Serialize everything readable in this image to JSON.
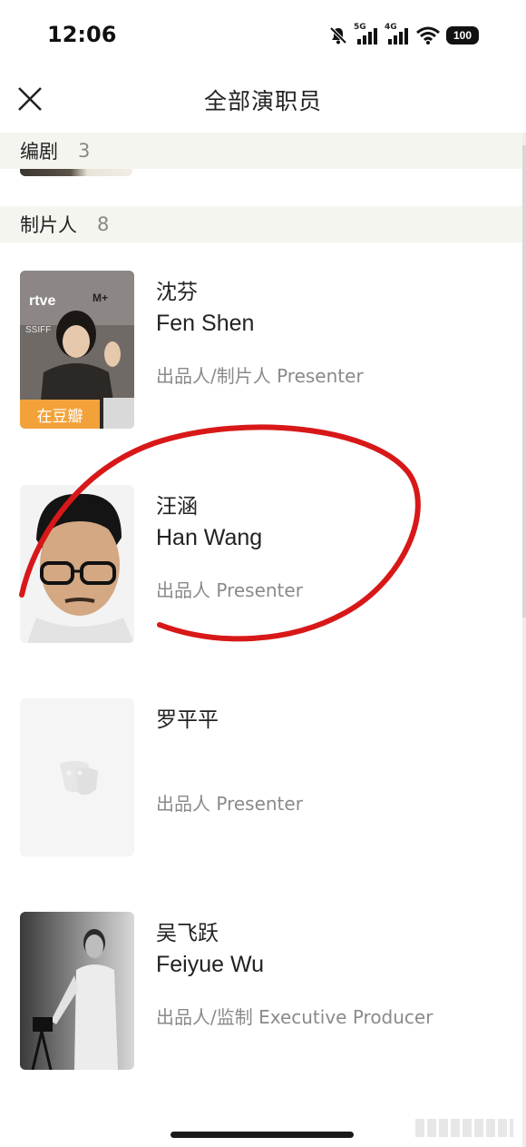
{
  "status_bar": {
    "time": "12:06",
    "signal_1_label": "5G",
    "signal_2_label": "4G",
    "battery": "100"
  },
  "header": {
    "title": "全部演职员",
    "close_icon": "close-icon"
  },
  "sections": [
    {
      "title": "编剧",
      "count": "3"
    },
    {
      "title": "制片人",
      "count": "8"
    }
  ],
  "cast": [
    {
      "name_cn": "沈芬",
      "name_en": "Fen Shen",
      "role": "出品人/制片人 Presenter",
      "badge": "在豆瓣"
    },
    {
      "name_cn": "汪涵",
      "name_en": "Han Wang",
      "role": "出品人 Presenter"
    },
    {
      "name_cn": "罗平平",
      "name_en": "",
      "role": "出品人 Presenter"
    },
    {
      "name_cn": "吴飞跃",
      "name_en": "Feiyue Wu",
      "role": "出品人/监制 Executive Producer"
    }
  ],
  "colors": {
    "section_bg": "#f5f5f0",
    "badge": "#f3a23a",
    "annotation": "#d81818"
  }
}
